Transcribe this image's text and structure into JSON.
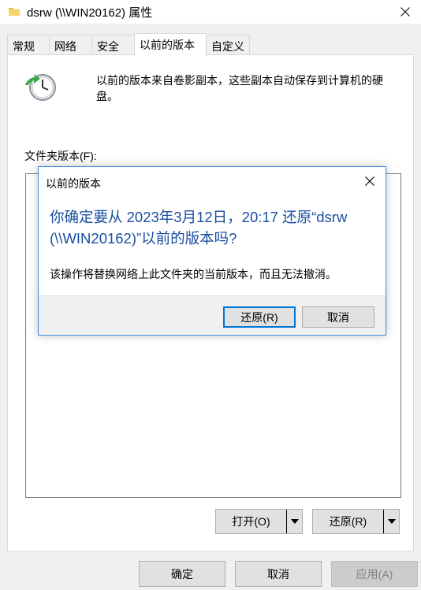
{
  "window": {
    "title": "dsrw (\\\\WIN20162) 属性"
  },
  "tabs": [
    {
      "label": "常规"
    },
    {
      "label": "网络"
    },
    {
      "label": "安全"
    },
    {
      "label": "以前的版本"
    },
    {
      "label": "自定义"
    }
  ],
  "active_tab": "以前的版本",
  "panel": {
    "intro_text": "以前的版本来自卷影副本，这些副本自动保存到计算机的硬盘。",
    "folder_versions_label": "文件夹版本(F):",
    "open_button": "打开(O)",
    "restore_button": "还原(R)"
  },
  "footer": {
    "ok_button": "确定",
    "cancel_button": "取消",
    "apply_button": "应用(A)"
  },
  "dialog": {
    "title": "以前的版本",
    "heading": "你确定要从 2023年3月12日，20:17 还原“dsrw (\\\\WIN20162)”以前的版本吗?",
    "body": "该操作将替换网络上此文件夹的当前版本，而且无法撤消。",
    "restore_button": "还原(R)",
    "cancel_button": "取消"
  },
  "icons": {
    "window_icon": "folder-icon",
    "panel_icon": "previous-versions-clock-icon"
  },
  "colors": {
    "accent": "#0078d7",
    "heading_text": "#1a4ea0",
    "dialog_border": "#3c8fd9"
  }
}
